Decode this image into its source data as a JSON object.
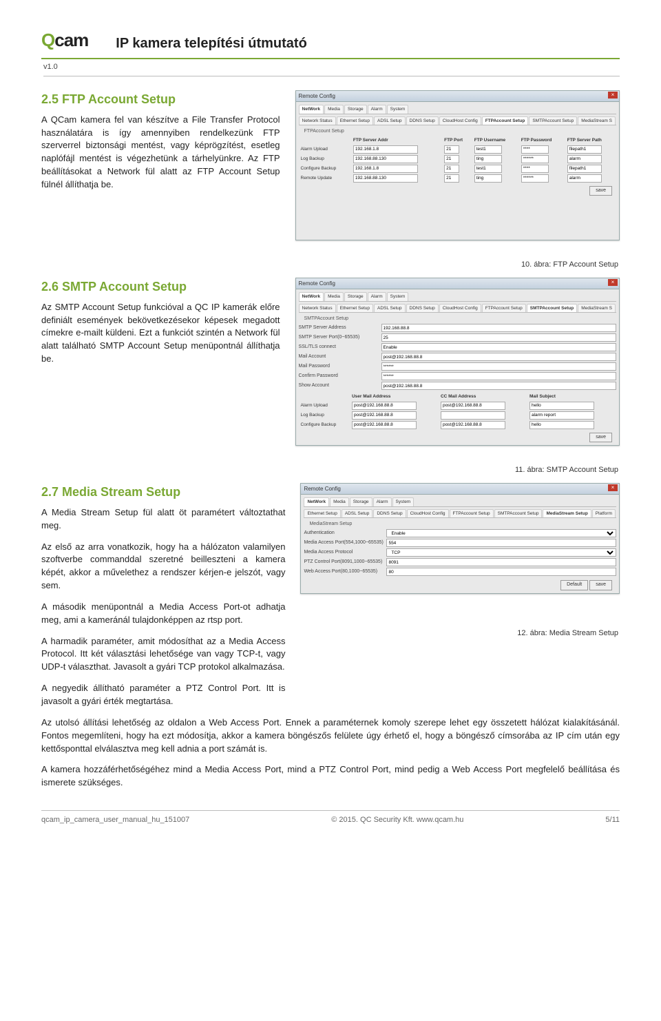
{
  "header": {
    "logo_pre": "Q",
    "logo_suf": "cam",
    "title": "IP kamera telepítési útmutató",
    "version": "v1.0"
  },
  "s25": {
    "heading": "2.5  FTP Account Setup",
    "p1": "A QCam kamera fel van készítve a File Transfer Protocol használatára is így amennyiben rendelkezünk FTP szerverrel biztonsági mentést, vagy képrögzítést, esetleg naplófájl mentést is végezhetünk a tárhelyünkre. Az FTP beállításokat a Network fül alatt az FTP Account Setup fülnél állíthatja be.",
    "caption": "10. ábra: FTP Account Setup"
  },
  "s26": {
    "heading": "2.6  SMTP Account Setup",
    "p1": "Az SMTP Account Setup funkcióval a QC IP kamerák előre definiált események bekövetkezésekor képesek megadott címekre e-mailt küldeni. Ezt a funkciót szintén a Network fül alatt található SMTP Account Setup menüpontnál állíthatja be.",
    "caption": "11. ábra: SMTP Account Setup"
  },
  "s27": {
    "heading": "2.7  Media Stream Setup",
    "p1": "A Media Stream Setup fül alatt öt paramétert változtathat meg.",
    "p2": "Az első az arra vonatkozik, hogy ha a hálózaton valamilyen szoftverbe commanddal szeretné beilleszteni a kamera képét, akkor a művelethez a rendszer kérjen-e jelszót, vagy sem.",
    "p3": "A második menüpontnál a Media Access Port-ot adhatja meg, ami a kameránál tulajdonképpen az rtsp port.",
    "p4": "A harmadik paraméter, amit módosíthat az a Media Access Protocol. Itt két választási lehetősége van vagy TCP-t, vagy UDP-t választhat. Javasolt a gyári TCP protokol alkalmazása.",
    "p5": "A negyedik állítható paraméter a PTZ Control Port. Itt is javasolt a gyári érték megtartása.",
    "p6": "Az utolsó állítási lehetőség az oldalon a Web Access Port. Ennek a paraméternek komoly szerepe lehet egy összetett hálózat kialakításánál. Fontos megemlíteni, hogy ha ezt módosítja, akkor a kamera böngészős felülete úgy érhető el, hogy a böngésző címsorába az IP cím után egy kettősponttal elválasztva meg kell adnia a port számát is.",
    "p7": "A kamera hozzáférhetőségéhez mind a Media Access Port, mind a PTZ Control Port, mind pedig a Web Access Port megfelelő beállítása és ismerete szükséges.",
    "caption": "12. ábra: Media Stream Setup"
  },
  "shot_common": {
    "win_title": "Remote Config",
    "main_tabs": [
      "NetWork",
      "Media",
      "Storage",
      "Alarm",
      "System"
    ]
  },
  "shot_ftp": {
    "sub_tabs": [
      "Network Status",
      "Ethernet Setup",
      "ADSL Setup",
      "DDNS Setup",
      "CloudHost Config",
      "FTPAccount Setup",
      "SMTPAccount Setup",
      "MediaStream S"
    ],
    "active_tab": "FTPAccount Setup",
    "panel": "FTPAccount Setup",
    "headers": [
      "",
      "FTP Server Addr",
      "FTP Port",
      "FTP Username",
      "FTP Password",
      "FTP Server Path"
    ],
    "rows": [
      [
        "Alarm Upload",
        "192.168.1.8",
        "21",
        "test1",
        "****",
        "filepath1"
      ],
      [
        "Log Backup",
        "192.168.88.130",
        "21",
        "ting",
        "******",
        "alarm"
      ],
      [
        "Configure Backup",
        "192.168.1.8",
        "21",
        "test1",
        "****",
        "filepath1"
      ],
      [
        "Remote Update",
        "192.168.88.130",
        "21",
        "ting",
        "******",
        "alarm"
      ]
    ],
    "save": "save"
  },
  "shot_smtp": {
    "sub_tabs": [
      "Network Status",
      "Ethernet Setup",
      "ADSL Setup",
      "DDNS Setup",
      "CloudHost Config",
      "FTPAccount Setup",
      "SMTPAccount Setup",
      "MediaStream S"
    ],
    "active_tab": "SMTPAccount Setup",
    "panel": "SMTPAccount Setup",
    "fields": [
      [
        "SMTP Server Address",
        "192.168.88.8"
      ],
      [
        "SMTP Server Port(0~65535)",
        "25"
      ],
      [
        "SSL/TLS connect",
        "Enable"
      ],
      [
        "Mail Account",
        "post@192.168.88.8"
      ],
      [
        "Mail Password",
        "******"
      ],
      [
        "Confirm Password",
        "******"
      ],
      [
        "Show Account",
        "post@192.168.88.8"
      ]
    ],
    "headers2": [
      "",
      "User Mail Address",
      "CC Mail Address",
      "Mail Subject"
    ],
    "rows2": [
      [
        "Alarm Upload",
        "post@192.168.88.8",
        "post@192.168.88.8",
        "hello"
      ],
      [
        "Log Backup",
        "post@192.168.88.8",
        "",
        "alarm report"
      ],
      [
        "Configure Backup",
        "post@192.168.88.8",
        "post@192.168.88.8",
        "hello"
      ]
    ],
    "save": "save"
  },
  "shot_media": {
    "sub_tabs": [
      "Ethernet Setup",
      "ADSL Setup",
      "DDNS Setup",
      "CloudHost Config",
      "FTPAccount Setup",
      "SMTPAccount Setup",
      "MediaStream Setup",
      "Platform"
    ],
    "active_tab": "MediaStream Setup",
    "panel": "MediaStream Setup",
    "fields": [
      [
        "Authentication",
        "Enable"
      ],
      [
        "Media Access Port(554,1000~65535)",
        "554"
      ],
      [
        "Media Access Protocol",
        "TCP"
      ],
      [
        "PTZ Control Port(8091,1000~65535)",
        "8091"
      ],
      [
        "Web Access Port(80,1000~65535)",
        "80"
      ]
    ],
    "default": "Default",
    "save": "save"
  },
  "footer": {
    "left": "qcam_ip_camera_user_manual_hu_151007",
    "mid": "© 2015. QC Security Kft.   www.qcam.hu",
    "right": "5/11"
  }
}
